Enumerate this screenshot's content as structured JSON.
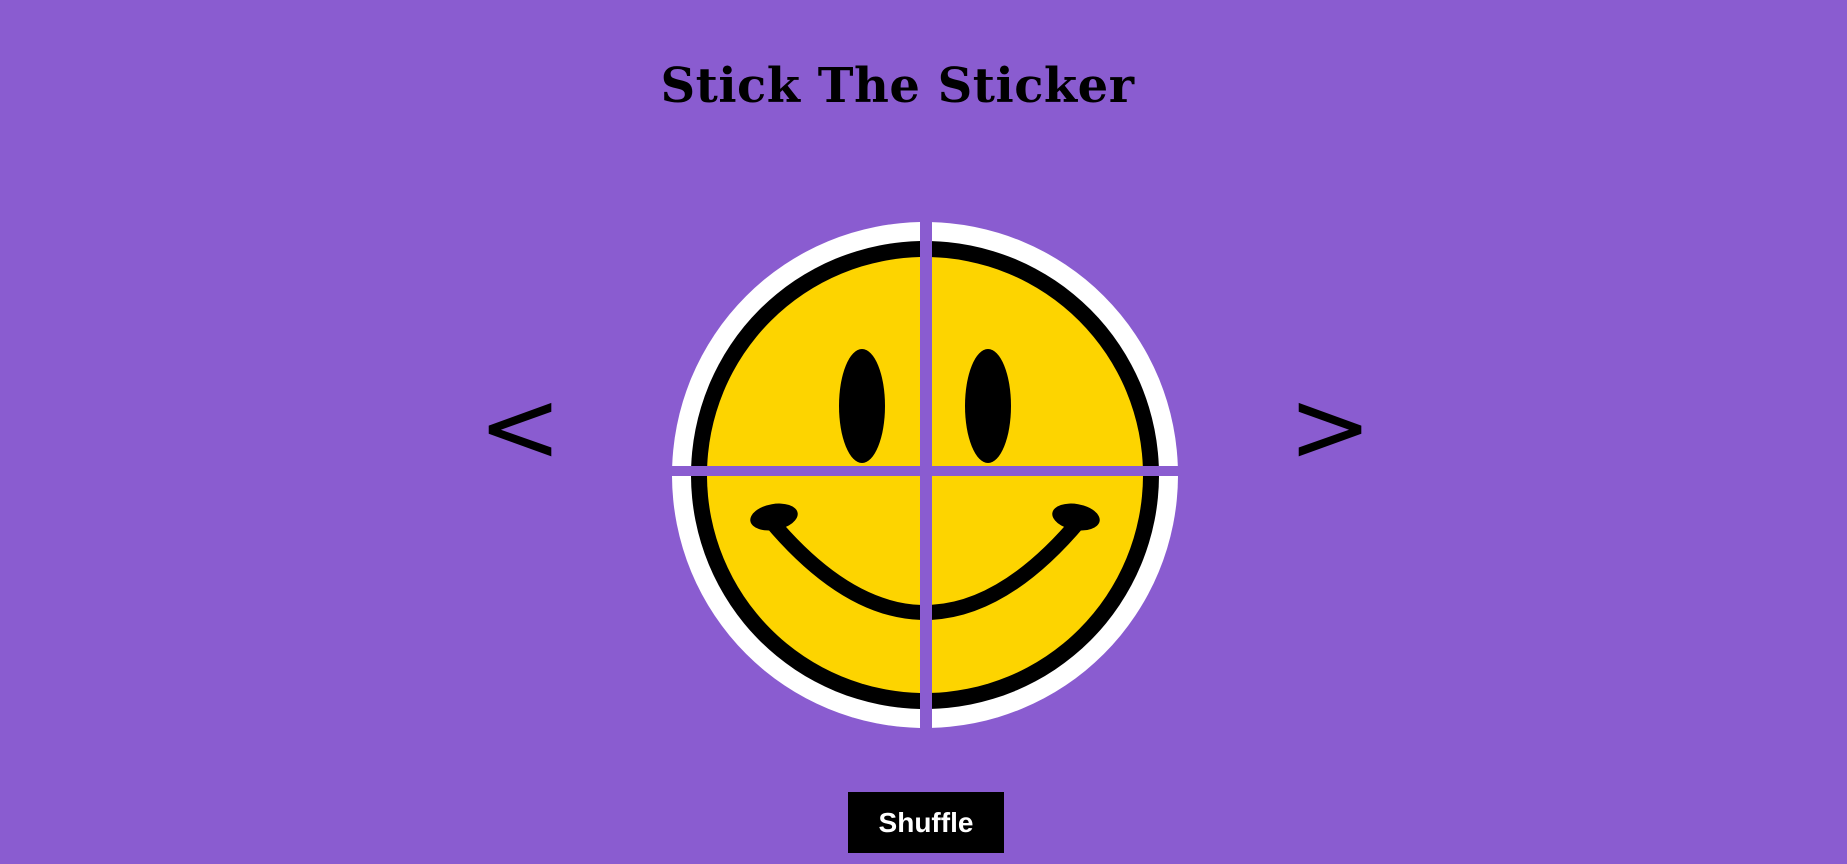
{
  "page": {
    "title": "Stick The Sticker"
  },
  "nav": {
    "prev_label": "<",
    "next_label": ">"
  },
  "puzzle": {
    "sticker_icon": "smiley-face-sticker",
    "pieces": [
      "top-left",
      "top-right",
      "bottom-left",
      "bottom-right"
    ],
    "colors": {
      "background": "#8a5cd0",
      "face": "#fdd400",
      "outline": "#000000",
      "border": "#ffffff"
    }
  },
  "controls": {
    "shuffle_label": "Shuffle"
  }
}
